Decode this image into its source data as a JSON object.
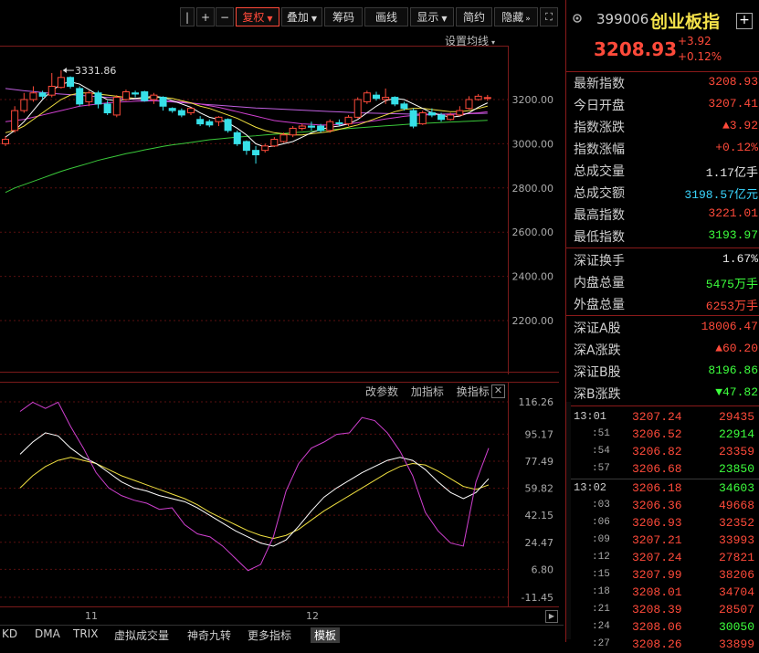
{
  "toolbar": {
    "buttons": [
      {
        "label": "+",
        "name": "zoom-in-button"
      },
      {
        "label": "−",
        "name": "zoom-out-button"
      },
      {
        "label": "复权",
        "name": "fuquan-dropdown",
        "dropdown": true,
        "active": true
      },
      {
        "label": "叠加",
        "name": "overlay-dropdown",
        "dropdown": true
      },
      {
        "label": "筹码",
        "name": "chips-button"
      },
      {
        "label": "画线",
        "name": "draw-line-button"
      },
      {
        "label": "显示",
        "name": "display-dropdown",
        "dropdown": true
      },
      {
        "label": "简约",
        "name": "simple-button"
      },
      {
        "label": "隐藏",
        "name": "hide-button",
        "chevron": true
      }
    ]
  },
  "ma_setting_label": "设置均线",
  "kline": {
    "y_ticks": [
      "3200.00",
      "3000.00",
      "2800.00",
      "2600.00",
      "2400.00",
      "2200.00"
    ],
    "max_marker": "3331.86",
    "candles": [
      {
        "o": 3000,
        "c": 3020,
        "h": 3035,
        "l": 2990
      },
      {
        "o": 3060,
        "c": 3150,
        "h": 3170,
        "l": 3050
      },
      {
        "o": 3150,
        "c": 3200,
        "h": 3230,
        "l": 3140
      },
      {
        "o": 3200,
        "c": 3230,
        "h": 3260,
        "l": 3190
      },
      {
        "o": 3230,
        "c": 3215,
        "h": 3240,
        "l": 3200
      },
      {
        "o": 3220,
        "c": 3260,
        "h": 3320,
        "l": 3210
      },
      {
        "o": 3255,
        "c": 3300,
        "h": 3332,
        "l": 3250
      },
      {
        "o": 3300,
        "c": 3260,
        "h": 3305,
        "l": 3250
      },
      {
        "o": 3250,
        "c": 3180,
        "h": 3260,
        "l": 3170
      },
      {
        "o": 3190,
        "c": 3230,
        "h": 3240,
        "l": 3170
      },
      {
        "o": 3230,
        "c": 3180,
        "h": 3240,
        "l": 3160
      },
      {
        "o": 3180,
        "c": 3140,
        "h": 3195,
        "l": 3130
      },
      {
        "o": 3130,
        "c": 3210,
        "h": 3220,
        "l": 3120
      },
      {
        "o": 3200,
        "c": 3235,
        "h": 3245,
        "l": 3195
      },
      {
        "o": 3230,
        "c": 3225,
        "h": 3240,
        "l": 3210
      },
      {
        "o": 3235,
        "c": 3195,
        "h": 3240,
        "l": 3190
      },
      {
        "o": 3200,
        "c": 3220,
        "h": 3230,
        "l": 3180
      },
      {
        "o": 3210,
        "c": 3170,
        "h": 3215,
        "l": 3150
      },
      {
        "o": 3160,
        "c": 3150,
        "h": 3165,
        "l": 3140
      },
      {
        "o": 3150,
        "c": 3130,
        "h": 3160,
        "l": 3120
      },
      {
        "o": 3140,
        "c": 3160,
        "h": 3165,
        "l": 3130
      },
      {
        "o": 3110,
        "c": 3090,
        "h": 3125,
        "l": 3080
      },
      {
        "o": 3100,
        "c": 3085,
        "h": 3110,
        "l": 3075
      },
      {
        "o": 3100,
        "c": 3120,
        "h": 3125,
        "l": 3080
      },
      {
        "o": 3110,
        "c": 3060,
        "h": 3115,
        "l": 3050
      },
      {
        "o": 3050,
        "c": 3000,
        "h": 3060,
        "l": 2990
      },
      {
        "o": 3010,
        "c": 2970,
        "h": 3015,
        "l": 2950
      },
      {
        "o": 2970,
        "c": 2950,
        "h": 2990,
        "l": 2910
      },
      {
        "o": 2970,
        "c": 2990,
        "h": 3000,
        "l": 2960
      },
      {
        "o": 2990,
        "c": 3020,
        "h": 3030,
        "l": 2985
      },
      {
        "o": 3010,
        "c": 3040,
        "h": 3050,
        "l": 3005
      },
      {
        "o": 3040,
        "c": 3070,
        "h": 3080,
        "l": 3030
      },
      {
        "o": 3070,
        "c": 3080,
        "h": 3090,
        "l": 3060
      },
      {
        "o": 3080,
        "c": 3075,
        "h": 3100,
        "l": 3060
      },
      {
        "o": 3080,
        "c": 3060,
        "h": 3090,
        "l": 3050
      },
      {
        "o": 3060,
        "c": 3100,
        "h": 3110,
        "l": 3050
      },
      {
        "o": 3095,
        "c": 3090,
        "h": 3110,
        "l": 3080
      },
      {
        "o": 3090,
        "c": 3120,
        "h": 3130,
        "l": 3080
      },
      {
        "o": 3120,
        "c": 3200,
        "h": 3210,
        "l": 3115
      },
      {
        "o": 3190,
        "c": 3230,
        "h": 3240,
        "l": 3180
      },
      {
        "o": 3220,
        "c": 3205,
        "h": 3235,
        "l": 3195
      },
      {
        "o": 3200,
        "c": 3210,
        "h": 3250,
        "l": 3180
      },
      {
        "o": 3210,
        "c": 3180,
        "h": 3215,
        "l": 3170
      },
      {
        "o": 3180,
        "c": 3160,
        "h": 3190,
        "l": 3150
      },
      {
        "o": 3150,
        "c": 3080,
        "h": 3160,
        "l": 3070
      },
      {
        "o": 3090,
        "c": 3140,
        "h": 3150,
        "l": 3085
      },
      {
        "o": 3140,
        "c": 3130,
        "h": 3160,
        "l": 3120
      },
      {
        "o": 3130,
        "c": 3110,
        "h": 3140,
        "l": 3100
      },
      {
        "o": 3110,
        "c": 3130,
        "h": 3140,
        "l": 3105
      },
      {
        "o": 3130,
        "c": 3150,
        "h": 3170,
        "l": 3125
      },
      {
        "o": 3160,
        "c": 3200,
        "h": 3215,
        "l": 3155
      },
      {
        "o": 3200,
        "c": 3215,
        "h": 3225,
        "l": 3195
      },
      {
        "o": 3207,
        "c": 3209,
        "h": 3221,
        "l": 3194
      }
    ],
    "ma5": [
      3030,
      3060,
      3100,
      3150,
      3200,
      3240,
      3270,
      3280,
      3270,
      3245,
      3220,
      3200,
      3195,
      3200,
      3205,
      3210,
      3215,
      3210,
      3195,
      3180,
      3165,
      3140,
      3120,
      3110,
      3095,
      3070,
      3040,
      3000,
      2985,
      2990,
      3000,
      3010,
      3030,
      3050,
      3065,
      3075,
      3080,
      3090,
      3110,
      3140,
      3170,
      3195,
      3205,
      3200,
      3180,
      3160,
      3140,
      3130,
      3120,
      3125,
      3140,
      3165,
      3185
    ],
    "ma10": [
      3050,
      3060,
      3080,
      3110,
      3140,
      3170,
      3200,
      3220,
      3230,
      3230,
      3225,
      3220,
      3215,
      3210,
      3205,
      3205,
      3210,
      3210,
      3205,
      3195,
      3185,
      3170,
      3160,
      3145,
      3130,
      3115,
      3095,
      3075,
      3060,
      3050,
      3045,
      3040,
      3040,
      3045,
      3050,
      3055,
      3065,
      3075,
      3085,
      3100,
      3115,
      3130,
      3145,
      3155,
      3160,
      3160,
      3155,
      3150,
      3145,
      3145,
      3150,
      3160,
      3170
    ],
    "ma20": [
      3100,
      3105,
      3110,
      3120,
      3130,
      3140,
      3150,
      3160,
      3170,
      3175,
      3180,
      3185,
      3188,
      3190,
      3192,
      3193,
      3195,
      3195,
      3193,
      3190,
      3185,
      3180,
      3172,
      3165,
      3155,
      3145,
      3135,
      3125,
      3115,
      3105,
      3100,
      3095,
      3090,
      3088,
      3085,
      3085,
      3087,
      3090,
      3095,
      3100,
      3105,
      3112,
      3118,
      3124,
      3128,
      3130,
      3132,
      3133,
      3134,
      3135,
      3137,
      3140,
      3145
    ],
    "ma60": [
      2780,
      2800,
      2815,
      2830,
      2845,
      2860,
      2875,
      2888,
      2900,
      2912,
      2925,
      2935,
      2945,
      2955,
      2963,
      2972,
      2980,
      2988,
      2995,
      3000,
      3006,
      3012,
      3018,
      3022,
      3026,
      3030,
      3033,
      3036,
      3040,
      3043,
      3046,
      3050,
      3053,
      3056,
      3060,
      3063,
      3066,
      3069,
      3072,
      3075,
      3078,
      3081,
      3084,
      3087,
      3090,
      3092,
      3094,
      3096,
      3098,
      3100,
      3102,
      3104,
      3106
    ],
    "ma120": [
      3250,
      3245,
      3240,
      3236,
      3232,
      3228,
      3225,
      3222,
      3219,
      3216,
      3213,
      3210,
      3207,
      3204,
      3201,
      3198,
      3195,
      3192,
      3189,
      3186,
      3183,
      3180,
      3177,
      3174,
      3171,
      3168,
      3165,
      3162,
      3160,
      3158,
      3156,
      3154,
      3152,
      3150,
      3148,
      3146,
      3144,
      3142,
      3140,
      3139,
      3138,
      3137,
      3136,
      3135,
      3134,
      3134,
      3134,
      3134,
      3135,
      3135,
      3136,
      3137,
      3138
    ]
  },
  "indicator": {
    "header": [
      "改参数",
      "加指标",
      "换指标"
    ],
    "y_ticks": [
      "116.26",
      "95.17",
      "77.49",
      "59.82",
      "42.15",
      "24.47",
      "6.80",
      "-11.45"
    ],
    "k": [
      82,
      90,
      96,
      94,
      86,
      80,
      76,
      70,
      64,
      60,
      58,
      55,
      53,
      51,
      47,
      42,
      37,
      32,
      28,
      24,
      22,
      26,
      35,
      45,
      54,
      60,
      65,
      70,
      74,
      78,
      80,
      78,
      72,
      64,
      57,
      53,
      57,
      66
    ],
    "d": [
      60,
      68,
      74,
      78,
      80,
      78,
      76,
      72,
      68,
      65,
      62,
      59,
      56,
      53,
      49,
      44,
      40,
      36,
      32,
      29,
      27,
      29,
      33,
      39,
      45,
      50,
      55,
      60,
      65,
      70,
      74,
      76,
      75,
      71,
      66,
      61,
      59,
      62
    ],
    "j": [
      110,
      116,
      112,
      116,
      100,
      86,
      70,
      60,
      55,
      52,
      50,
      46,
      47,
      36,
      30,
      28,
      22,
      14,
      6,
      10,
      28,
      58,
      76,
      86,
      90,
      95,
      96,
      106,
      104,
      96,
      84,
      68,
      44,
      32,
      24,
      22,
      64,
      86
    ]
  },
  "x_labels": [
    "11",
    "12"
  ],
  "bottom_tabs": [
    "KD",
    "DMA",
    "TRIX",
    "虚拟成交量",
    "神奇九转",
    "更多指标",
    "模板"
  ],
  "stock": {
    "code": "399006",
    "name": "创业板指",
    "price": "3208.93",
    "change_abs": "+3.92",
    "change_pct": "+0.12%"
  },
  "quote_rows": [
    {
      "label": "最新指数",
      "value": "3208.93",
      "color": "#ff4a3a"
    },
    {
      "label": "今日开盘",
      "value": "3207.41",
      "color": "#ff4a3a"
    },
    {
      "label": "指数涨跌",
      "value": "▲3.92",
      "color": "#ff4a3a"
    },
    {
      "label": "指数涨幅",
      "value": "+0.12%",
      "color": "#ff4a3a"
    },
    {
      "label": "总成交量",
      "value": "1.17亿手",
      "color": "#e8e8e8"
    },
    {
      "label": "总成交额",
      "value": "3198.57亿元",
      "color": "#3ad6ff"
    },
    {
      "label": "最高指数",
      "value": "3221.01",
      "color": "#ff4a3a"
    },
    {
      "label": "最低指数",
      "value": "3193.97",
      "color": "#3dff3d"
    },
    {
      "label": "深证换手",
      "value": "1.67%",
      "color": "#e8e8e8"
    },
    {
      "label": "内盘总量",
      "value": "5475万手",
      "color": "#3dff3d"
    },
    {
      "label": "外盘总量",
      "value": "6253万手",
      "color": "#ff4a3a"
    },
    {
      "label": "深证A股",
      "value": "18006.47",
      "color": "#ff4a3a"
    },
    {
      "label": "深A涨跌",
      "value": "▲60.20",
      "color": "#ff4a3a"
    },
    {
      "label": "深证B股",
      "value": "8196.86",
      "color": "#3dff3d"
    },
    {
      "label": "深B涨跌",
      "value": "▼47.82",
      "color": "#3dff3d"
    }
  ],
  "ticks": [
    {
      "time": "13:01",
      "main": true,
      "price": "3207.24",
      "vol": "29435",
      "vc": "#ff4a3a"
    },
    {
      "time": ":51",
      "main": false,
      "price": "3206.52",
      "vol": "22914",
      "vc": "#3dff3d"
    },
    {
      "time": ":54",
      "main": false,
      "price": "3206.82",
      "vol": "23359",
      "vc": "#ff4a3a"
    },
    {
      "time": ":57",
      "main": false,
      "price": "3206.68",
      "vol": "23850",
      "vc": "#3dff3d"
    },
    {
      "time": "13:02",
      "main": true,
      "price": "3206.18",
      "vol": "34603",
      "vc": "#3dff3d"
    },
    {
      "time": ":03",
      "main": false,
      "price": "3206.36",
      "vol": "49668",
      "vc": "#ff4a3a"
    },
    {
      "time": ":06",
      "main": false,
      "price": "3206.93",
      "vol": "32352",
      "vc": "#ff4a3a"
    },
    {
      "time": ":09",
      "main": false,
      "price": "3207.21",
      "vol": "33993",
      "vc": "#ff4a3a"
    },
    {
      "time": ":12",
      "main": false,
      "price": "3207.24",
      "vol": "27821",
      "vc": "#ff4a3a"
    },
    {
      "time": ":15",
      "main": false,
      "price": "3207.99",
      "vol": "38206",
      "vc": "#ff4a3a"
    },
    {
      "time": ":18",
      "main": false,
      "price": "3208.01",
      "vol": "34704",
      "vc": "#ff4a3a"
    },
    {
      "time": ":21",
      "main": false,
      "price": "3208.39",
      "vol": "28507",
      "vc": "#ff4a3a"
    },
    {
      "time": ":24",
      "main": false,
      "price": "3208.06",
      "vol": "30050",
      "vc": "#3dff3d"
    },
    {
      "time": ":27",
      "main": false,
      "price": "3208.26",
      "vol": "33899",
      "vc": "#ff4a3a"
    }
  ],
  "colors": {
    "up": "#ff4a3a",
    "down": "#37e0e8",
    "ma5": "#ffffff",
    "ma10": "#f0e040",
    "ma20": "#d040d0",
    "ma60": "#3ac83a",
    "ma120": "#c060e0"
  }
}
